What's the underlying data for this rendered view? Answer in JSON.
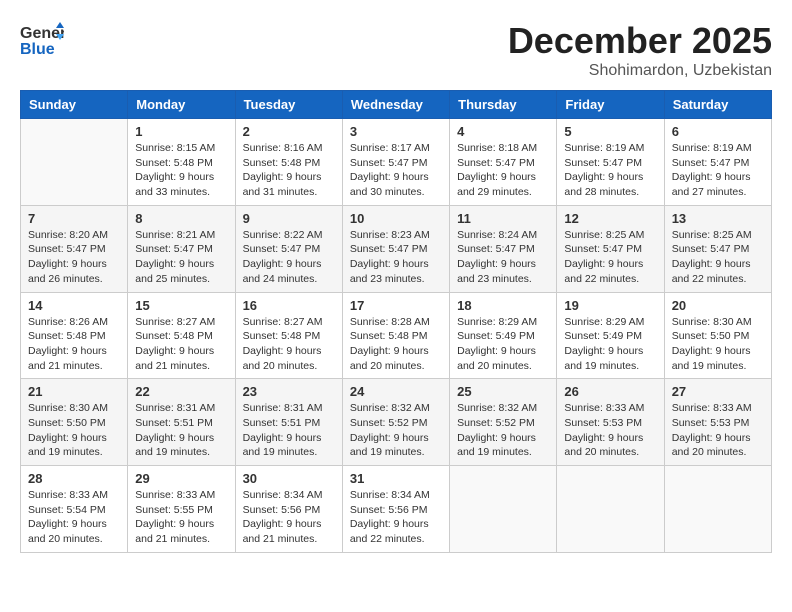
{
  "header": {
    "logo_line1": "General",
    "logo_line2": "Blue",
    "month": "December 2025",
    "location": "Shohimardon, Uzbekistan"
  },
  "weekdays": [
    "Sunday",
    "Monday",
    "Tuesday",
    "Wednesday",
    "Thursday",
    "Friday",
    "Saturday"
  ],
  "weeks": [
    [
      {
        "day": "",
        "info": ""
      },
      {
        "day": "1",
        "info": "Sunrise: 8:15 AM\nSunset: 5:48 PM\nDaylight: 9 hours\nand 33 minutes."
      },
      {
        "day": "2",
        "info": "Sunrise: 8:16 AM\nSunset: 5:48 PM\nDaylight: 9 hours\nand 31 minutes."
      },
      {
        "day": "3",
        "info": "Sunrise: 8:17 AM\nSunset: 5:47 PM\nDaylight: 9 hours\nand 30 minutes."
      },
      {
        "day": "4",
        "info": "Sunrise: 8:18 AM\nSunset: 5:47 PM\nDaylight: 9 hours\nand 29 minutes."
      },
      {
        "day": "5",
        "info": "Sunrise: 8:19 AM\nSunset: 5:47 PM\nDaylight: 9 hours\nand 28 minutes."
      },
      {
        "day": "6",
        "info": "Sunrise: 8:19 AM\nSunset: 5:47 PM\nDaylight: 9 hours\nand 27 minutes."
      }
    ],
    [
      {
        "day": "7",
        "info": ""
      },
      {
        "day": "8",
        "info": "Sunrise: 8:21 AM\nSunset: 5:47 PM\nDaylight: 9 hours\nand 25 minutes."
      },
      {
        "day": "9",
        "info": "Sunrise: 8:22 AM\nSunset: 5:47 PM\nDaylight: 9 hours\nand 24 minutes."
      },
      {
        "day": "10",
        "info": "Sunrise: 8:23 AM\nSunset: 5:47 PM\nDaylight: 9 hours\nand 23 minutes."
      },
      {
        "day": "11",
        "info": "Sunrise: 8:24 AM\nSunset: 5:47 PM\nDaylight: 9 hours\nand 23 minutes."
      },
      {
        "day": "12",
        "info": "Sunrise: 8:25 AM\nSunset: 5:47 PM\nDaylight: 9 hours\nand 22 minutes."
      },
      {
        "day": "13",
        "info": "Sunrise: 8:25 AM\nSunset: 5:47 PM\nDaylight: 9 hours\nand 22 minutes."
      }
    ],
    [
      {
        "day": "14",
        "info": ""
      },
      {
        "day": "15",
        "info": "Sunrise: 8:27 AM\nSunset: 5:48 PM\nDaylight: 9 hours\nand 21 minutes."
      },
      {
        "day": "16",
        "info": "Sunrise: 8:27 AM\nSunset: 5:48 PM\nDaylight: 9 hours\nand 20 minutes."
      },
      {
        "day": "17",
        "info": "Sunrise: 8:28 AM\nSunset: 5:48 PM\nDaylight: 9 hours\nand 20 minutes."
      },
      {
        "day": "18",
        "info": "Sunrise: 8:29 AM\nSunset: 5:49 PM\nDaylight: 9 hours\nand 20 minutes."
      },
      {
        "day": "19",
        "info": "Sunrise: 8:29 AM\nSunset: 5:49 PM\nDaylight: 9 hours\nand 19 minutes."
      },
      {
        "day": "20",
        "info": "Sunrise: 8:30 AM\nSunset: 5:50 PM\nDaylight: 9 hours\nand 19 minutes."
      }
    ],
    [
      {
        "day": "21",
        "info": ""
      },
      {
        "day": "22",
        "info": "Sunrise: 8:31 AM\nSunset: 5:51 PM\nDaylight: 9 hours\nand 19 minutes."
      },
      {
        "day": "23",
        "info": "Sunrise: 8:31 AM\nSunset: 5:51 PM\nDaylight: 9 hours\nand 19 minutes."
      },
      {
        "day": "24",
        "info": "Sunrise: 8:32 AM\nSunset: 5:52 PM\nDaylight: 9 hours\nand 19 minutes."
      },
      {
        "day": "25",
        "info": "Sunrise: 8:32 AM\nSunset: 5:52 PM\nDaylight: 9 hours\nand 19 minutes."
      },
      {
        "day": "26",
        "info": "Sunrise: 8:33 AM\nSunset: 5:53 PM\nDaylight: 9 hours\nand 20 minutes."
      },
      {
        "day": "27",
        "info": "Sunrise: 8:33 AM\nSunset: 5:53 PM\nDaylight: 9 hours\nand 20 minutes."
      }
    ],
    [
      {
        "day": "28",
        "info": "Sunrise: 8:33 AM\nSunset: 5:54 PM\nDaylight: 9 hours\nand 20 minutes."
      },
      {
        "day": "29",
        "info": "Sunrise: 8:33 AM\nSunset: 5:55 PM\nDaylight: 9 hours\nand 21 minutes."
      },
      {
        "day": "30",
        "info": "Sunrise: 8:34 AM\nSunset: 5:56 PM\nDaylight: 9 hours\nand 21 minutes."
      },
      {
        "day": "31",
        "info": "Sunrise: 8:34 AM\nSunset: 5:56 PM\nDaylight: 9 hours\nand 22 minutes."
      },
      {
        "day": "",
        "info": ""
      },
      {
        "day": "",
        "info": ""
      },
      {
        "day": "",
        "info": ""
      }
    ]
  ],
  "week7_infos": [
    "Sunrise: 8:20 AM\nSunset: 5:47 PM\nDaylight: 9 hours\nand 26 minutes.",
    "Sunrise: 8:26 AM\nSunset: 5:48 PM\nDaylight: 9 hours\nand 21 minutes.",
    "Sunrise: 8:30 AM\nSunset: 5:50 PM\nDaylight: 9 hours\nand 19 minutes."
  ]
}
